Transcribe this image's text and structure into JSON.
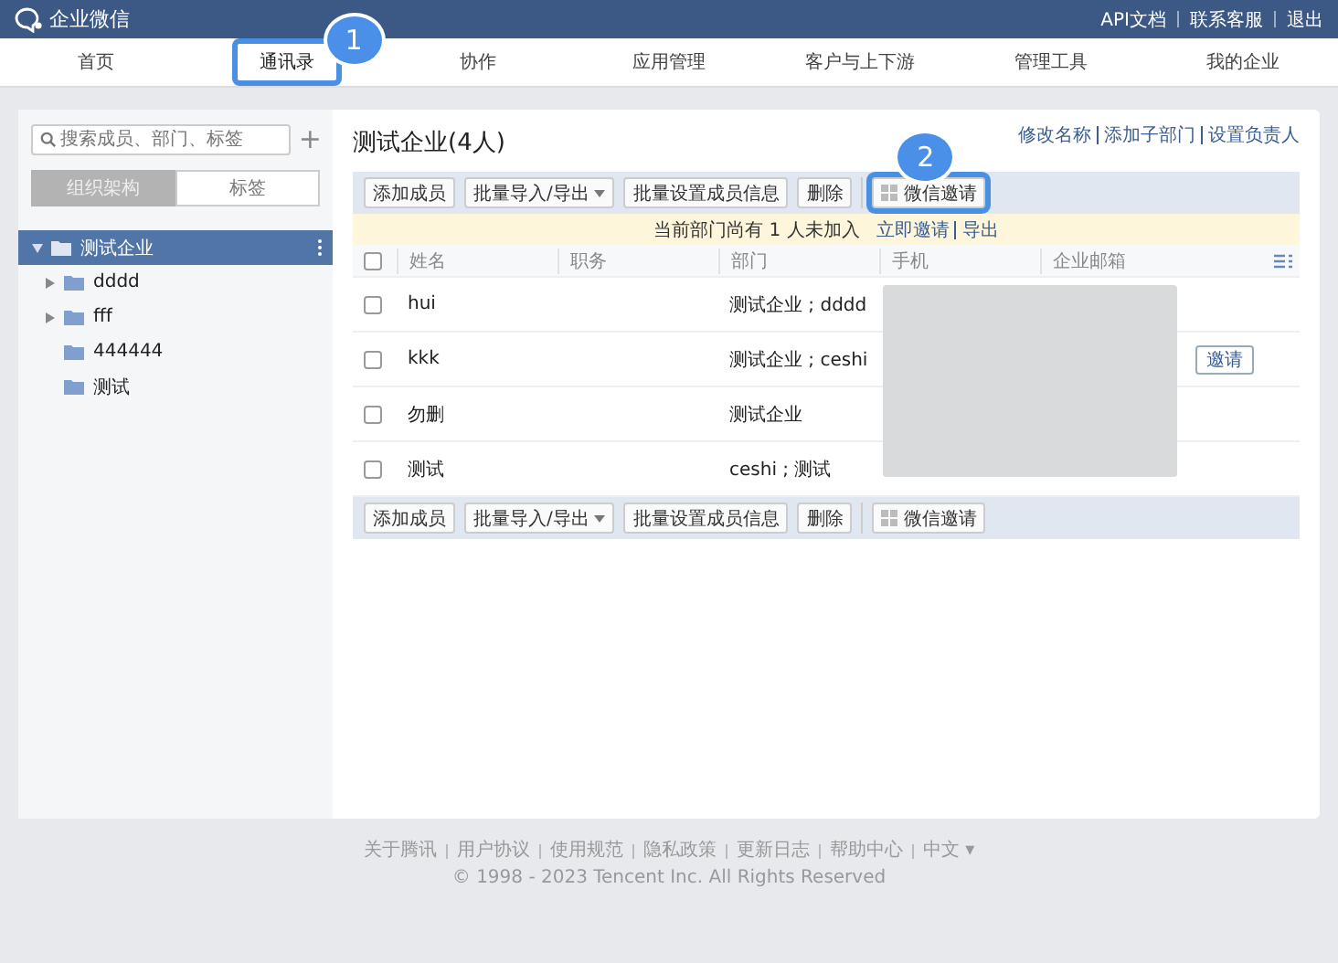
{
  "top_bar": {
    "logo": "企业微信",
    "links": [
      "API文档",
      "联系客服",
      "退出"
    ]
  },
  "nav": [
    {
      "label": "首页",
      "selected": false,
      "highlighted": false
    },
    {
      "label": "通讯录",
      "selected": true,
      "highlighted": true,
      "callout": "1"
    },
    {
      "label": "协作",
      "selected": false,
      "highlighted": false
    },
    {
      "label": "应用管理",
      "selected": false,
      "highlighted": false
    },
    {
      "label": "客户与上下游",
      "selected": false,
      "highlighted": false
    },
    {
      "label": "管理工具",
      "selected": false,
      "highlighted": false
    },
    {
      "label": "我的企业",
      "selected": false,
      "highlighted": false
    }
  ],
  "sidebar": {
    "search": {
      "placeholder": "搜索成员、部门、标签"
    },
    "add": "+",
    "tabs": [
      {
        "label": "组织架构",
        "selected": true
      },
      {
        "label": "标签",
        "selected": false
      }
    ],
    "tree": [
      {
        "label": "测试企业",
        "selected": true,
        "expanded": true,
        "children": [
          {
            "label": "dddd",
            "selected": false,
            "expanded": false,
            "has_children": true
          },
          {
            "label": "fff",
            "selected": false,
            "expanded": false,
            "has_children": true
          },
          {
            "label": "444444",
            "selected": false,
            "has_children": false
          },
          {
            "label": "测试",
            "selected": false,
            "has_children": false
          }
        ]
      }
    ]
  },
  "main": {
    "title": "测试企业(4人)",
    "actions": [
      "修改名称",
      "添加子部门",
      "设置负责人"
    ],
    "toolbar": [
      {
        "label": "添加成员",
        "kind": "plain",
        "highlighted": false
      },
      {
        "label": "批量导入/导出",
        "kind": "dropdown",
        "highlighted": false
      },
      {
        "label": "批量设置成员信息",
        "kind": "plain",
        "highlighted": false
      },
      {
        "label": "删除",
        "kind": "plain",
        "highlighted": false
      },
      {
        "label": "微信邀请",
        "kind": "qr",
        "highlighted": true,
        "callout": "2"
      }
    ],
    "notice": {
      "text": "当前部门尚有 1 人未加入",
      "links": [
        "立即邀请",
        "导出"
      ]
    },
    "all_checked": false,
    "columns": [
      "姓名",
      "职务",
      "部门",
      "手机",
      "企业邮箱"
    ],
    "rows": [
      {
        "checked": false,
        "name": "hui",
        "dept": "测试企业 ; dddd"
      },
      {
        "checked": false,
        "name": "kkk",
        "dept": "测试企业 ; ceshi",
        "invite": "邀请"
      },
      {
        "checked": false,
        "name": "勿删",
        "dept": "测试企业"
      },
      {
        "checked": false,
        "name": "测试",
        "dept": "ceshi ; 测试"
      }
    ],
    "bottom_toolbar": [
      {
        "label": "添加成员",
        "kind": "plain"
      },
      {
        "label": "批量导入/导出",
        "kind": "dropdown"
      },
      {
        "label": "批量设置成员信息",
        "kind": "plain"
      },
      {
        "label": "删除",
        "kind": "plain"
      },
      {
        "label": "微信邀请",
        "kind": "qr"
      }
    ]
  },
  "footer": {
    "links": [
      "关于腾讯",
      "用户协议",
      "使用规范",
      "隐私政策",
      "更新日志",
      "帮助中心"
    ],
    "language": "中文 ▾",
    "copyright": "© 1998 - 2023 Tencent Inc. All Rights Reserved"
  }
}
